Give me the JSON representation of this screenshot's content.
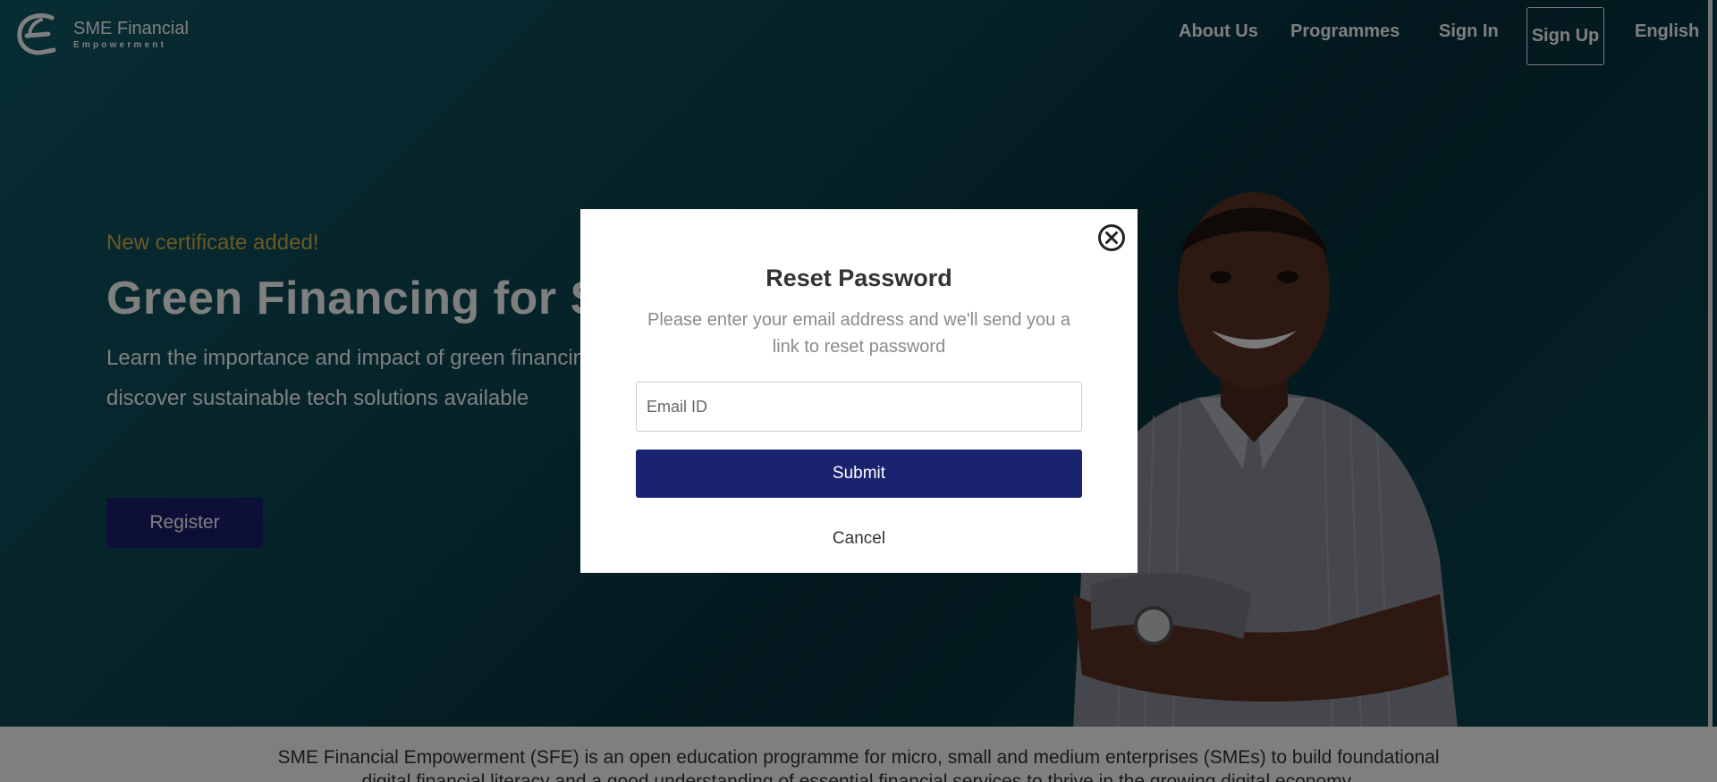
{
  "brand": {
    "line1": "SME Financial",
    "line2": "Empowerment"
  },
  "nav": {
    "about": "About Us",
    "programmes": "Programmes",
    "signin": "Sign In",
    "signup": "Sign Up",
    "language": "English"
  },
  "hero": {
    "tagline": "New certificate added!",
    "headline": "Green Financing for SMEs",
    "description": "Learn the importance and impact of green financing and discover sustainable tech solutions available",
    "register": "Register"
  },
  "about": {
    "text": "SME Financial Empowerment (SFE) is an open education programme for micro, small and medium enterprises (SMEs) to build foundational",
    "text2": "digital financial literacy and a good understanding of essential financial services to thrive in the growing digital economy."
  },
  "modal": {
    "title": "Reset Password",
    "subtitle": "Please enter your email address and we'll send you a link to reset password",
    "email_placeholder": "Email ID",
    "submit": "Submit",
    "cancel": "Cancel"
  },
  "colors": {
    "primary": "#1a2370",
    "accent": "#d7b24a",
    "hero_bg": "#0b4753"
  }
}
